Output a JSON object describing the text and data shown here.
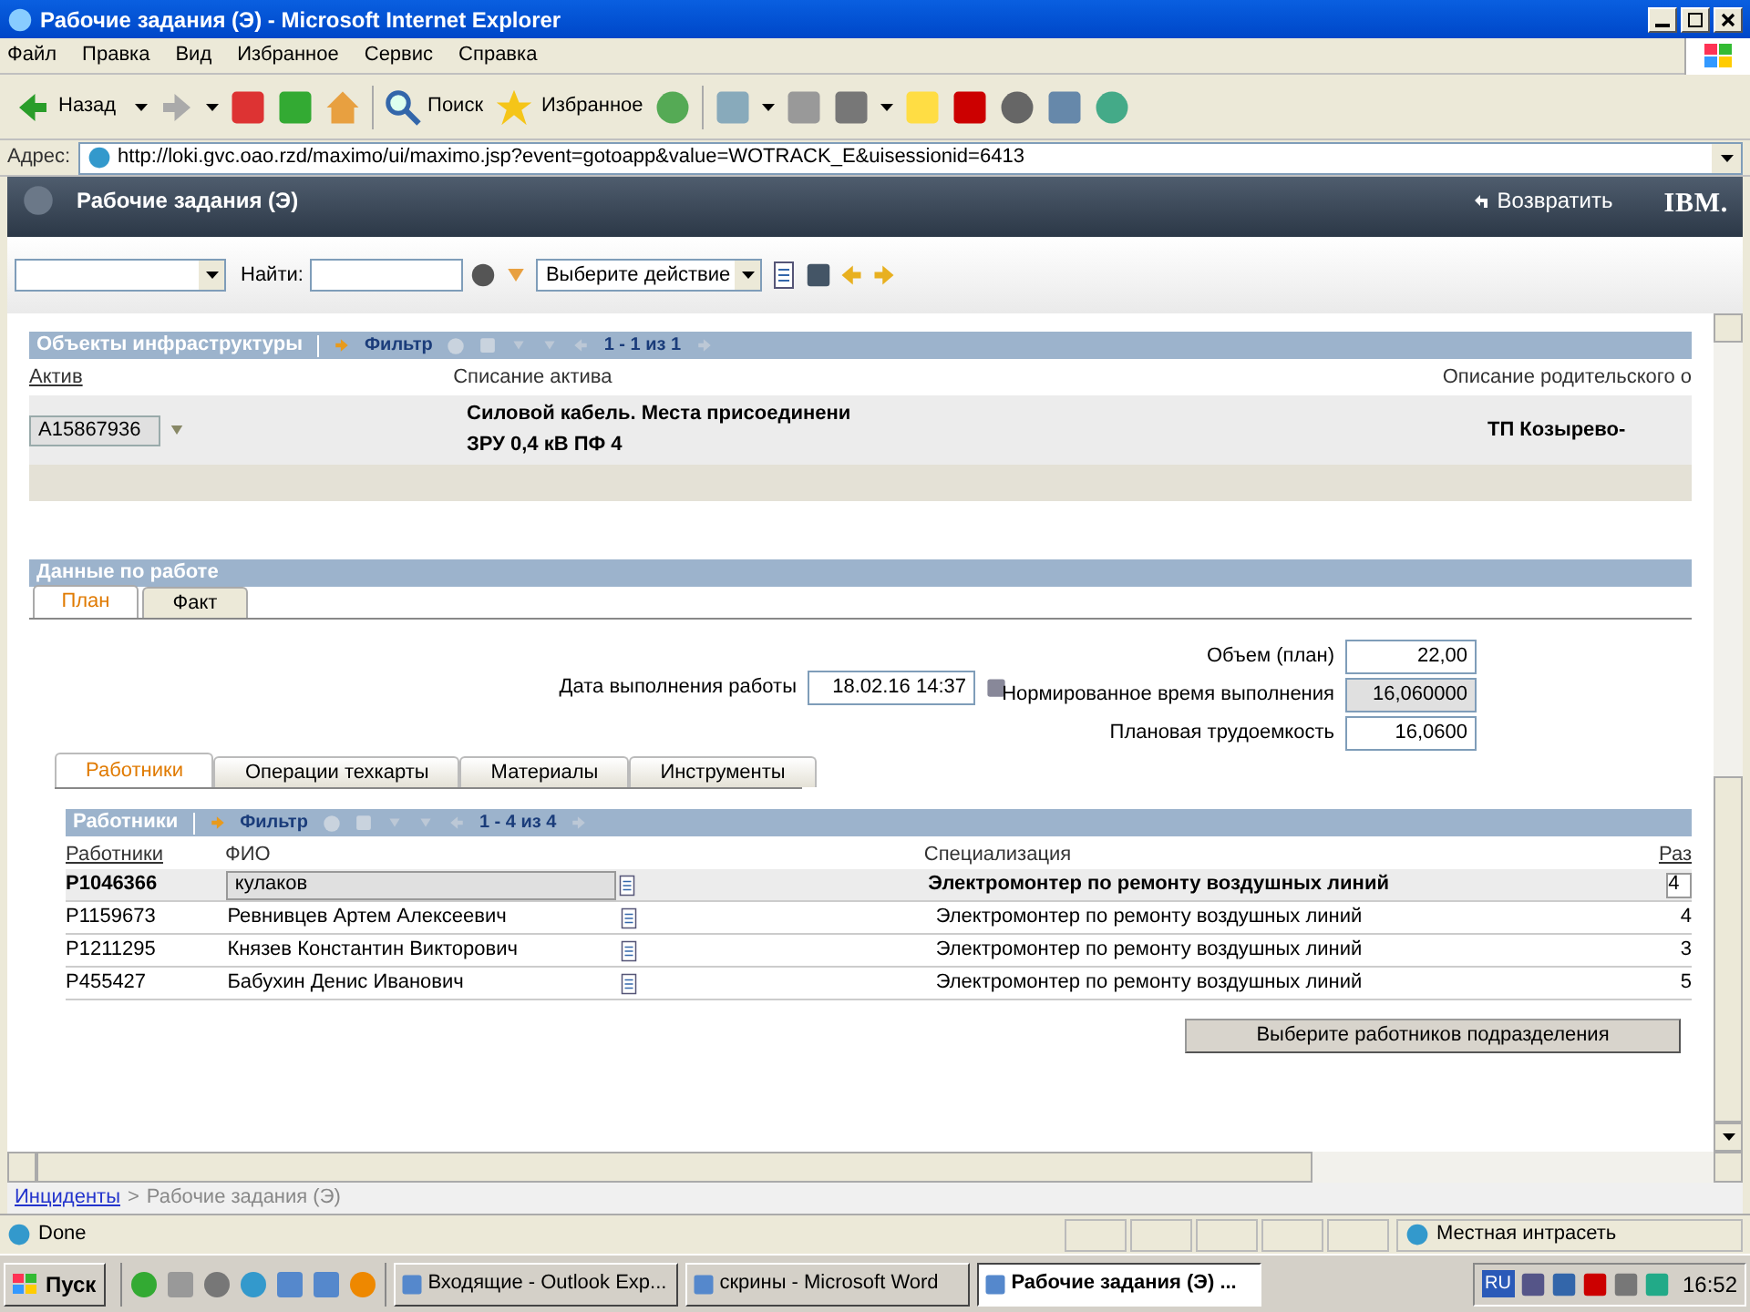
{
  "window": {
    "title": "Рабочие задания (Э) - Microsoft Internet Explorer"
  },
  "menu": [
    "Файл",
    "Правка",
    "Вид",
    "Избранное",
    "Сервис",
    "Справка"
  ],
  "toolbar": {
    "back": "Назад",
    "search": "Поиск",
    "favorites": "Избранное"
  },
  "address": {
    "label": "Адрес:",
    "url": "http://loki.gvc.oao.rzd/maximo/ui/maximo.jsp?event=gotoapp&value=WOTRACK_E&uisessionid=6413"
  },
  "app_header": {
    "title": "Рабочие задания (Э)",
    "return_link": "Возвратить",
    "logo": "IBM."
  },
  "app_toolbar": {
    "find_label": "Найти:",
    "action": "Выберите действие"
  },
  "assets": {
    "title": "Объекты инфраструктуры",
    "filter": "Фильтр",
    "pager": "1 - 1 из 1",
    "columns": [
      "Актив",
      "Списание актива",
      "Описание родительского о"
    ],
    "row": {
      "asset": "A15867936",
      "description": [
        "Силовой кабель. Места присоединени",
        "ЗРУ 0,4 кВ ПФ 4"
      ],
      "parent": "ТП Козырево-"
    }
  },
  "work": {
    "title": "Данные по работе",
    "tabs": [
      {
        "label": "План",
        "selected": true
      },
      {
        "label": "Факт",
        "selected": false
      }
    ],
    "date": {
      "label": "Дата выполнения работы",
      "value": "18.02.16 14:37"
    },
    "fields": [
      {
        "label": "Объем (план)",
        "value": "22,00",
        "readonly": false
      },
      {
        "label": "Нормированное время выполнения",
        "value": "16,060000",
        "readonly": true
      },
      {
        "label": "Плановая трудоемкость",
        "value": "16,0600",
        "readonly": false
      }
    ],
    "subtabs": [
      {
        "label": "Работники",
        "selected": true
      },
      {
        "label": "Операции техкарты",
        "selected": false
      },
      {
        "label": "Материалы",
        "selected": false
      },
      {
        "label": "Инструменты",
        "selected": false
      }
    ]
  },
  "workers": {
    "title": "Работники",
    "filter": "Фильтр",
    "pager": "1 - 4 из 4",
    "columns": [
      "Работники",
      "ФИО",
      "Специализация",
      "Раз"
    ],
    "rows": [
      {
        "id": "P1046366",
        "name": "кулаков",
        "specialty": "Электромонтер по ремонту воздушных линий",
        "column_4": "4",
        "selected": true
      },
      {
        "id": "P1159673",
        "name": "Ревнивцев Артем Алексеевич",
        "specialty": "Электромонтер по ремонту воздушных линий",
        "column_4": "4",
        "selected": false
      },
      {
        "id": "P1211295",
        "name": "Князев Константин Викторович",
        "specialty": "Электромонтер по ремонту воздушных линий",
        "column_4": "3",
        "selected": false
      },
      {
        "id": "P455427",
        "name": "Бабухин Денис Иванович",
        "specialty": "Электромонтер по ремонту воздушных линий",
        "column_4": "5",
        "selected": false
      }
    ],
    "button": "Выберите работников подразделения"
  },
  "breadcrumb": {
    "link": "Инциденты",
    "separator": ">",
    "current": "Рабочие задания (Э)"
  },
  "status_bar": {
    "text": "Done",
    "zone": "Местная интрасеть"
  },
  "taskbar": {
    "start": "Пуск",
    "tasks": [
      {
        "label": "Входящие - Outlook Exp...",
        "selected": false
      },
      {
        "label": "скрины - Microsoft Word",
        "selected": false
      },
      {
        "label": "Рабочие задания (Э) ...",
        "selected": true
      }
    ],
    "language": "RU",
    "clock": "16:52"
  }
}
